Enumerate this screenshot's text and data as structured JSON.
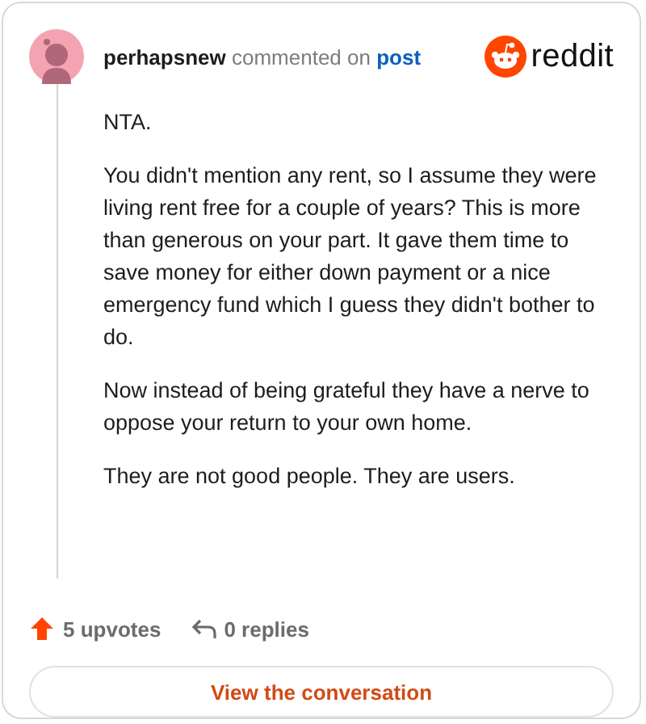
{
  "author": {
    "name": "perhapsnew",
    "action": "commented on",
    "link": "post"
  },
  "brand": "reddit",
  "paragraphs": [
    "NTA.",
    "You didn't mention any rent, so I assume they were living rent free for a couple of years? This is more than generous on your part. It gave them time to save money for either down payment or a nice emergency fund which I guess they didn't bother to do.",
    "Now instead of being grateful they have a nerve to oppose your return to your own home.",
    "They are not good people. They are users."
  ],
  "upvotes": "5 upvotes",
  "replies": "0 replies",
  "button": "View the conversation"
}
